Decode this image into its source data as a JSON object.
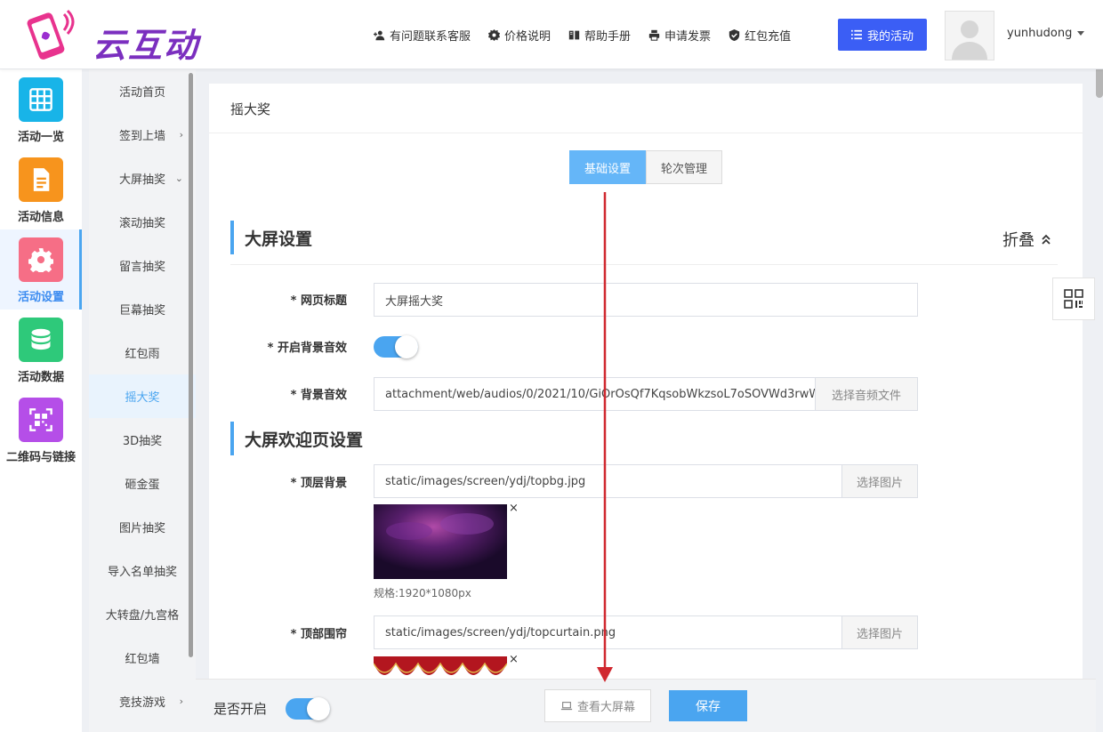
{
  "header": {
    "logo_text": "云互动",
    "nav": [
      {
        "label": "有问题联系客服",
        "icon": "user-plus-icon"
      },
      {
        "label": "价格说明",
        "icon": "gear-badge-icon"
      },
      {
        "label": "帮助手册",
        "icon": "book-icon"
      },
      {
        "label": "申请发票",
        "icon": "printer-icon"
      },
      {
        "label": "红包充值",
        "icon": "shield-check-icon"
      }
    ],
    "my_activity": "我的活动",
    "username": "yunhudong"
  },
  "icon_nav": [
    {
      "label": "活动一览",
      "color": "#18b4e8",
      "icon": "grid-icon",
      "active": false
    },
    {
      "label": "活动信息",
      "color": "#f7941d",
      "icon": "document-icon",
      "active": false
    },
    {
      "label": "活动设置",
      "color": "#f66e86",
      "icon": "gear-icon",
      "active": true
    },
    {
      "label": "活动数据",
      "color": "#2ec97a",
      "icon": "database-icon",
      "active": false
    },
    {
      "label": "二维码与链接",
      "color": "#b54ee8",
      "icon": "qrcode-icon",
      "active": false
    }
  ],
  "sub_nav": [
    {
      "label": "活动首页",
      "arrow": ""
    },
    {
      "label": "签到上墙",
      "arrow": "›"
    },
    {
      "label": "大屏抽奖",
      "arrow": "⌄"
    },
    {
      "label": "滚动抽奖",
      "arrow": ""
    },
    {
      "label": "留言抽奖",
      "arrow": ""
    },
    {
      "label": "巨幕抽奖",
      "arrow": ""
    },
    {
      "label": "红包雨",
      "arrow": ""
    },
    {
      "label": "摇大奖",
      "arrow": "",
      "active": true
    },
    {
      "label": "3D抽奖",
      "arrow": ""
    },
    {
      "label": "砸金蛋",
      "arrow": ""
    },
    {
      "label": "图片抽奖",
      "arrow": ""
    },
    {
      "label": "导入名单抽奖",
      "arrow": ""
    },
    {
      "label": "大转盘/九宫格",
      "arrow": ""
    },
    {
      "label": "红包墙",
      "arrow": ""
    },
    {
      "label": "竞技游戏",
      "arrow": "›"
    }
  ],
  "main": {
    "title": "摇大奖",
    "tabs": [
      "基础设置",
      "轮次管理"
    ],
    "section1": {
      "title": "大屏设置",
      "fold_label": "折叠"
    },
    "fields": {
      "page_title": {
        "label": "* 网页标题",
        "value": "大屏摇大奖"
      },
      "bg_music_toggle": {
        "label": "* 开启背景音效",
        "on": true
      },
      "bg_music": {
        "label": "* 背景音效",
        "value": "attachment/web/audios/0/2021/10/GiOrOsQf7KqsobWkzsoL7oSOVWd3rwW",
        "button": "选择音频文件"
      }
    },
    "section2": {
      "title": "大屏欢迎页设置"
    },
    "fields2": {
      "top_bg": {
        "label": "* 顶层背景",
        "value": "static/images/screen/ydj/topbg.jpg",
        "button": "选择图片",
        "spec": "规格:1920*1080px"
      },
      "top_curtain": {
        "label": "* 顶部围帘",
        "value": "static/images/screen/ydj/topcurtain.png",
        "button": "选择图片"
      }
    },
    "close_mark": "×"
  },
  "footer": {
    "enable_label": "是否开启",
    "enable_on": true,
    "view_screen": "查看大屏幕",
    "save": "保存"
  },
  "colors": {
    "accent": "#4aa5f0",
    "primary_button": "#3b5ef5",
    "annotation_arrow": "#d0282f"
  }
}
